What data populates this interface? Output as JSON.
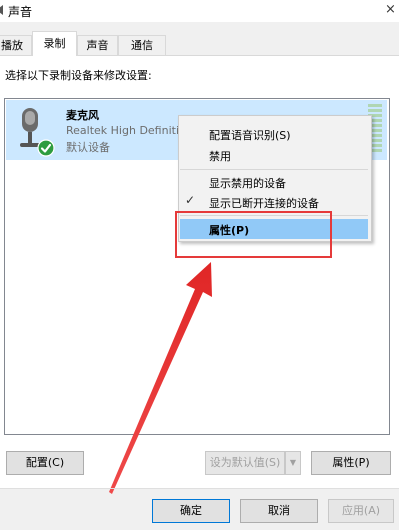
{
  "window": {
    "title": "声音",
    "close": "×"
  },
  "tabs": [
    {
      "label": "播放"
    },
    {
      "label": "录制",
      "active": true
    },
    {
      "label": "声音"
    },
    {
      "label": "通信"
    }
  ],
  "instruction": "选择以下录制设备来修改设置:",
  "device": {
    "name": "麦克风",
    "description": "Realtek High Definiti",
    "status": "默认设备"
  },
  "context_menu": {
    "items": [
      "配置语音识别(S)",
      "禁用",
      "显示禁用的设备",
      "显示已断开连接的设备",
      "属性(P)"
    ],
    "checked_item": "显示已断开连接的设备",
    "check_glyph": "✓"
  },
  "buttons": {
    "configure": "配置(C)",
    "set_default": "设为默认值(S)",
    "properties": "属性(P)",
    "ok": "确定",
    "cancel": "取消",
    "apply": "应用(A)"
  },
  "icons": {
    "microphone": "microphone-icon",
    "default_check": "green-check-icon",
    "dropdown": "chevron-down-icon"
  },
  "colors": {
    "selection": "#cce8ff",
    "menu_highlight": "#91c9f7",
    "annotation_red": "#e53a3a",
    "default_badge": "#2e9c3f"
  }
}
